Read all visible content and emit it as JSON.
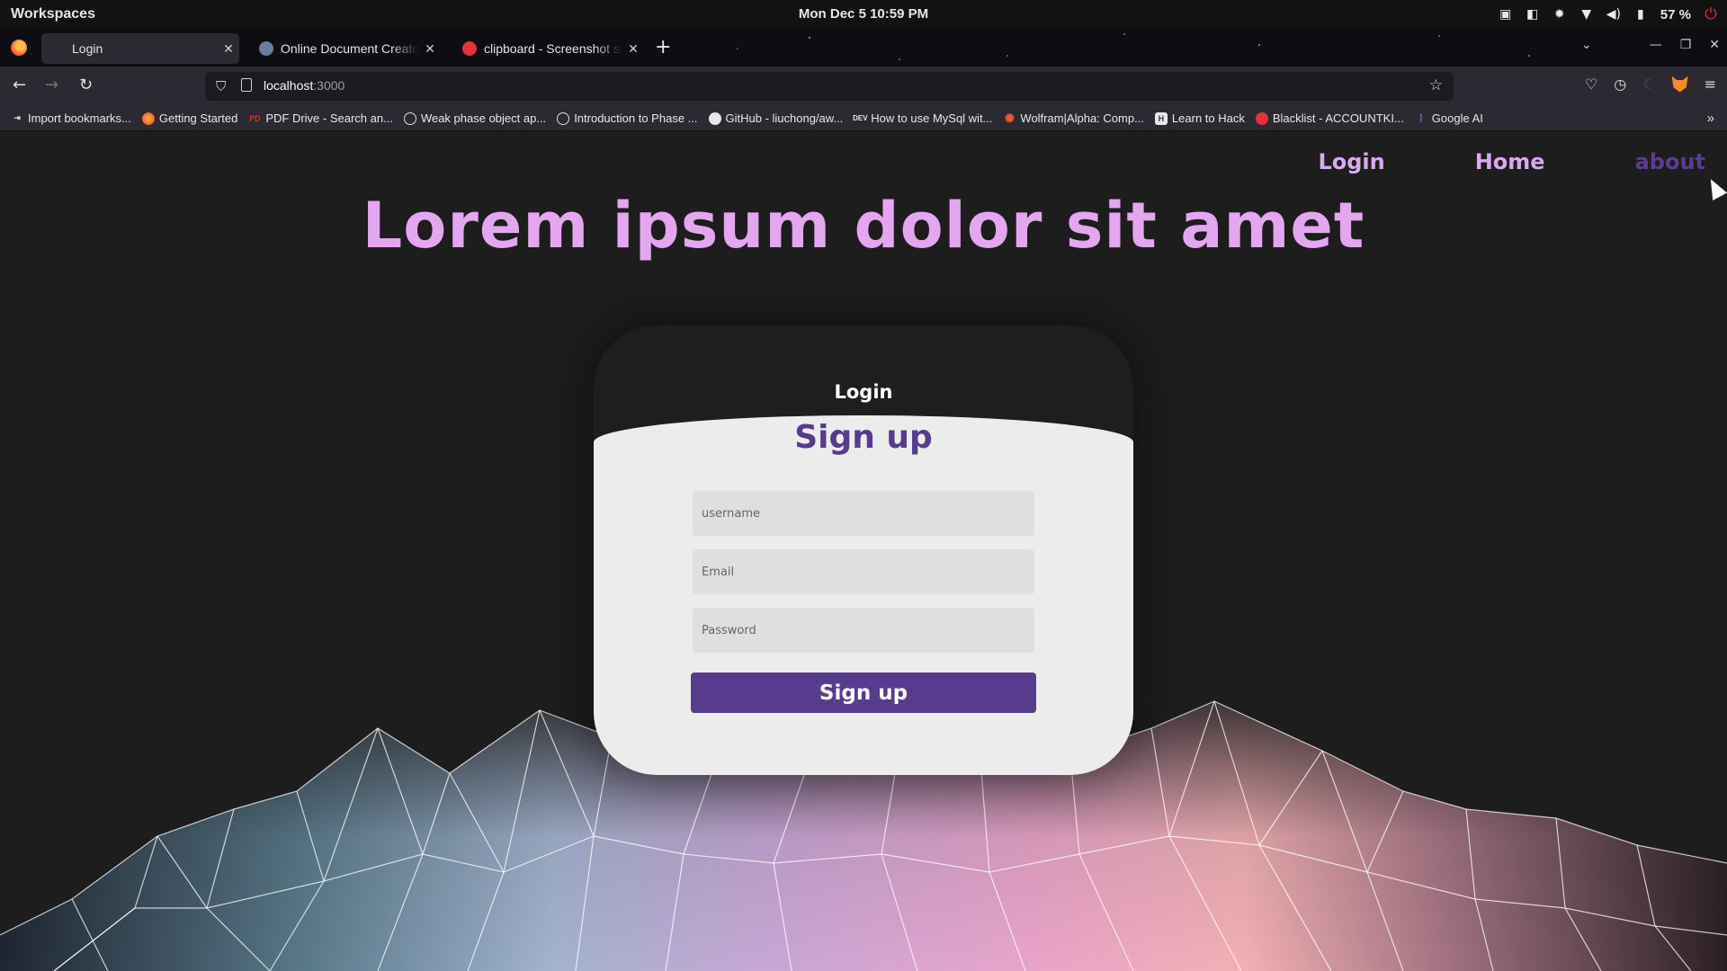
{
  "os": {
    "workspaces_label": "Workspaces",
    "clock": "Mon Dec 5  10:59 PM",
    "battery": "57 %"
  },
  "browser": {
    "tabs": [
      {
        "title": "Login",
        "active": true,
        "icon_color": "#2b2a33"
      },
      {
        "title": "Online Document Creator - ",
        "active": false,
        "icon_color": "#6a7fa0"
      },
      {
        "title": "clipboard - Screenshot sele",
        "active": false,
        "icon_color": "#e8303a"
      }
    ],
    "url_host": "localhost",
    "url_port": ":3000",
    "bookmarks": [
      {
        "label": "Import bookmarks...",
        "icon": "import-icon",
        "color": "#e8e8e8"
      },
      {
        "label": "Getting Started",
        "icon": "firefox-icon",
        "color": "#ff7a2a"
      },
      {
        "label": "PDF Drive - Search an...",
        "icon": "pdf-icon",
        "color": "#d0322f"
      },
      {
        "label": "Weak phase object ap...",
        "icon": "globe-icon",
        "color": "#e8e8e8"
      },
      {
        "label": "Introduction to Phase ...",
        "icon": "globe-icon",
        "color": "#e8e8e8"
      },
      {
        "label": "GitHub - liuchong/aw...",
        "icon": "github-icon",
        "color": "#e8e8e8"
      },
      {
        "label": "How to use MySql wit...",
        "icon": "dev-icon",
        "color": "#e8e8e8"
      },
      {
        "label": "Wolfram|Alpha: Comp...",
        "icon": "wolfram-icon",
        "color": "#f0562b"
      },
      {
        "label": "Learn to Hack",
        "icon": "hack-icon",
        "color": "#3a6fd8"
      },
      {
        "label": "Blacklist - ACCOUNTKI...",
        "icon": "blacklist-icon",
        "color": "#e8303a"
      },
      {
        "label": "Google AI",
        "icon": "google-ai-icon",
        "color": "#4a8af4"
      }
    ]
  },
  "site": {
    "nav": {
      "login": "Login",
      "home": "Home",
      "about": "about"
    },
    "hero_title": "Lorem ipsum dolor sit amet",
    "card": {
      "login_tab": "Login",
      "signup_title": "Sign up",
      "username_placeholder": "username",
      "email_placeholder": "Email",
      "password_placeholder": "Password",
      "submit_label": "Sign up"
    },
    "colors": {
      "accent": "#573b8c",
      "hero": "#e5a6f0",
      "nav": "#d9a8ee"
    }
  }
}
